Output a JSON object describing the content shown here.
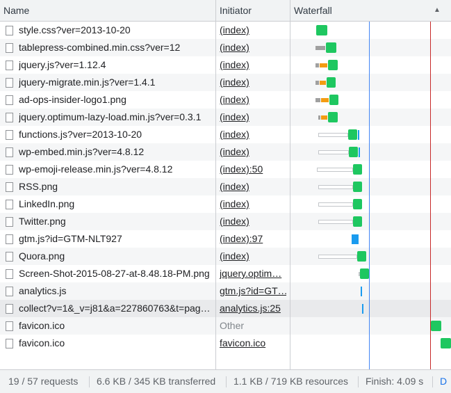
{
  "columns": {
    "name": "Name",
    "initiator": "Initiator",
    "waterfall": "Waterfall"
  },
  "sort_icon": "▲",
  "colors": {
    "header_bg": "#f1f3f4",
    "grid": "#cbcdd1",
    "download": "#1ec760",
    "waiting": "#1a9bef",
    "queued": "#d7dadd",
    "connecting": "#f39c12",
    "stalled": "#a0a0a0",
    "dom_content_loaded": "#4285f4",
    "load": "#c62828"
  },
  "requests": [
    {
      "name": "style.css?ver=2013-10-20",
      "initiator": "(index)",
      "initiator_link": true
    },
    {
      "name": "tablepress-combined.min.css?ver=12",
      "initiator": "(index)",
      "initiator_link": true
    },
    {
      "name": "jquery.js?ver=1.12.4",
      "initiator": "(index)",
      "initiator_link": true
    },
    {
      "name": "jquery-migrate.min.js?ver=1.4.1",
      "initiator": "(index)",
      "initiator_link": true
    },
    {
      "name": "ad-ops-insider-logo1.png",
      "initiator": "(index)",
      "initiator_link": true
    },
    {
      "name": "jquery.optimum-lazy-load.min.js?ver=0.3.1",
      "initiator": "(index)",
      "initiator_link": true
    },
    {
      "name": "functions.js?ver=2013-10-20",
      "initiator": "(index)",
      "initiator_link": true
    },
    {
      "name": "wp-embed.min.js?ver=4.8.12",
      "initiator": "(index)",
      "initiator_link": true
    },
    {
      "name": "wp-emoji-release.min.js?ver=4.8.12",
      "initiator": "(index):50",
      "initiator_link": true
    },
    {
      "name": "RSS.png",
      "initiator": "(index)",
      "initiator_link": true
    },
    {
      "name": "LinkedIn.png",
      "initiator": "(index)",
      "initiator_link": true
    },
    {
      "name": "Twitter.png",
      "initiator": "(index)",
      "initiator_link": true
    },
    {
      "name": "gtm.js?id=GTM-NLT927",
      "initiator": "(index):97",
      "initiator_link": true
    },
    {
      "name": "Quora.png",
      "initiator": "(index)",
      "initiator_link": true
    },
    {
      "name": "Screen-Shot-2015-08-27-at-8.48.18-PM.png",
      "initiator": "jquery.optim…",
      "initiator_link": true
    },
    {
      "name": "analytics.js",
      "initiator": "gtm.js?id=GT…",
      "initiator_link": true
    },
    {
      "name": "collect?v=1&_v=j81&a=227860763&t=pag…",
      "initiator": "analytics.js:25",
      "initiator_link": true,
      "highlighted": true
    },
    {
      "name": "favicon.ico",
      "initiator": "Other",
      "initiator_link": false
    },
    {
      "name": "favicon.ico",
      "initiator": "favicon.ico",
      "initiator_link": true
    }
  ],
  "summary": {
    "requests": "19 / 57 requests",
    "transferred": "6.6 KB / 345 KB transferred",
    "resources": "1.1 KB / 719 KB resources",
    "finish": "Finish: 4.09 s",
    "dom_content_loaded": "D"
  }
}
